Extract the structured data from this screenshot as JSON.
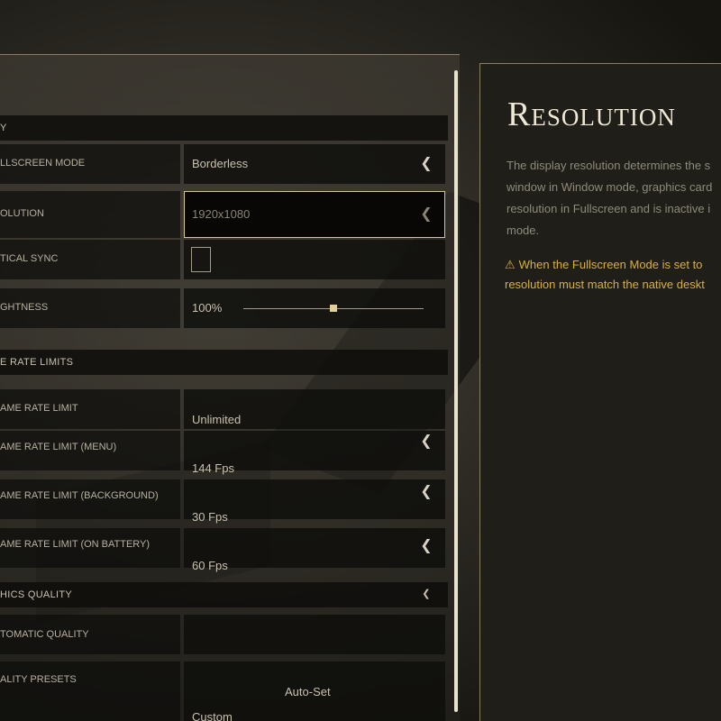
{
  "sections": {
    "display": "Y",
    "frame_rate_limits": "E RATE LIMITS",
    "graphics_quality": "HICS QUALITY"
  },
  "rows": {
    "fullscreen_mode": {
      "label": "LLSCREEN MODE",
      "value": "Borderless"
    },
    "resolution": {
      "label": "OLUTION",
      "value": "1920x1080"
    },
    "vertical_sync": {
      "label": "TICAL SYNC"
    },
    "brightness": {
      "label": "GHTNESS",
      "value": "100%",
      "level_fraction": 0.5
    },
    "frame_rate_limit": {
      "label": "AME RATE LIMIT",
      "value": "Unlimited"
    },
    "frame_rate_limit_menu": {
      "label": "AME RATE LIMIT (MENU)",
      "value": "144 Fps"
    },
    "frame_rate_limit_background": {
      "label": "AME RATE LIMIT (BACKGROUND)",
      "value": "30 Fps"
    },
    "frame_rate_limit_battery": {
      "label": "AME RATE LIMIT (ON BATTERY)",
      "value": "60 Fps"
    },
    "automatic_quality": {
      "label": "TOMATIC QUALITY"
    },
    "quality_presets": {
      "label": "ALITY PRESETS",
      "value": "Auto-Set",
      "sub_value": "Custom"
    }
  },
  "info": {
    "title": "Resolution",
    "lines": [
      "The display resolution determines the s",
      "window in Window mode, graphics card",
      "resolution in Fullscreen and is inactive i",
      "mode."
    ],
    "warning_lines": [
      "When the Fullscreen Mode is set to",
      "resolution must match the native deskt"
    ],
    "warning_icon": "⚠"
  },
  "icons": {
    "arrow": "❮",
    "warning": "warning-icon",
    "chevron": "chevron-left-icon"
  },
  "colors": {
    "accent_gold": "#d9c68f",
    "warning": "#d9b13a",
    "text": "#c9c1ae"
  }
}
